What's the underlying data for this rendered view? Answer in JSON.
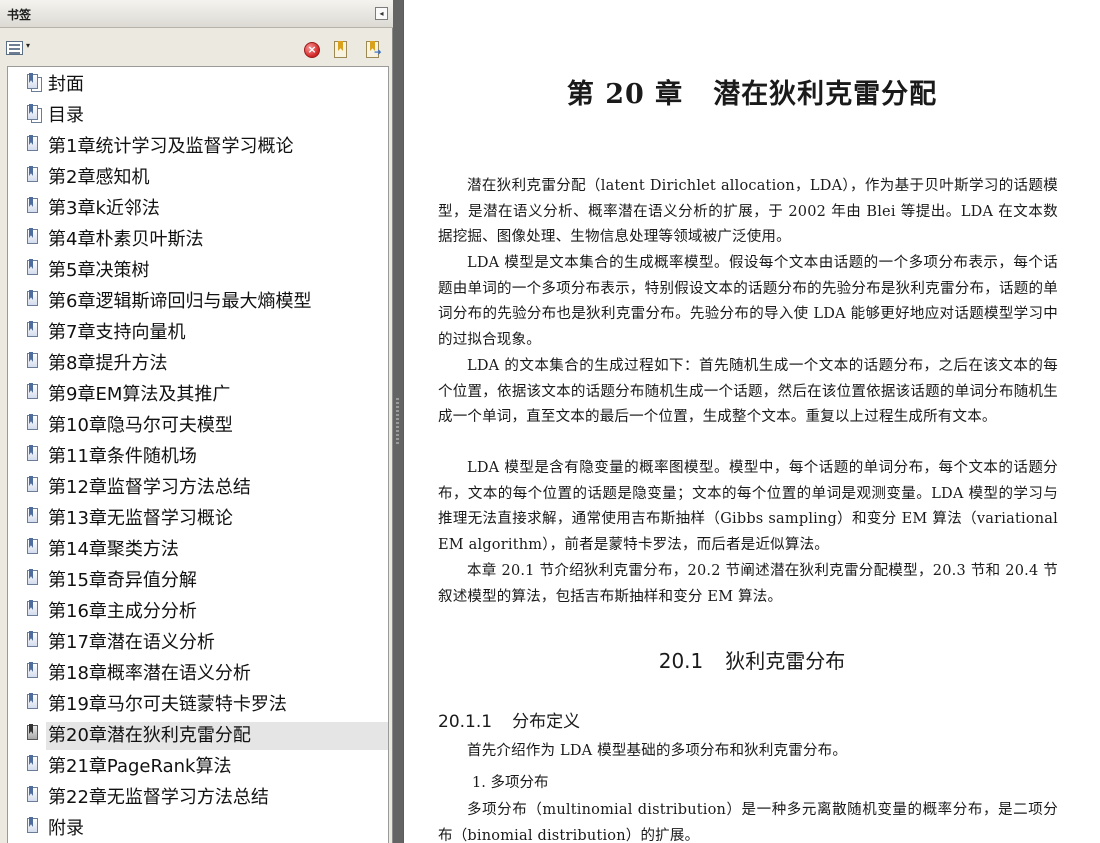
{
  "panel": {
    "title": "书签",
    "collapse_glyph": "◂",
    "options_caret": "▾",
    "delete_glyph": "×",
    "bookmarks": [
      {
        "label": "封面",
        "icon": "bookmark-multi-icon"
      },
      {
        "label": "目录",
        "icon": "bookmark-multi-icon"
      },
      {
        "label": "第1章统计学习及监督学习概论",
        "icon": "bookmark-icon"
      },
      {
        "label": "第2章感知机",
        "icon": "bookmark-icon"
      },
      {
        "label": "第3章k近邻法",
        "icon": "bookmark-icon"
      },
      {
        "label": "第4章朴素贝叶斯法",
        "icon": "bookmark-icon"
      },
      {
        "label": "第5章决策树",
        "icon": "bookmark-icon"
      },
      {
        "label": "第6章逻辑斯谛回归与最大熵模型",
        "icon": "bookmark-icon"
      },
      {
        "label": "第7章支持向量机",
        "icon": "bookmark-icon"
      },
      {
        "label": "第8章提升方法",
        "icon": "bookmark-icon"
      },
      {
        "label": "第9章EM算法及其推广",
        "icon": "bookmark-icon"
      },
      {
        "label": "第10章隐马尔可夫模型",
        "icon": "bookmark-icon"
      },
      {
        "label": "第11章条件随机场",
        "icon": "bookmark-icon"
      },
      {
        "label": "第12章监督学习方法总结",
        "icon": "bookmark-icon"
      },
      {
        "label": "第13章无监督学习概论",
        "icon": "bookmark-icon"
      },
      {
        "label": "第14章聚类方法",
        "icon": "bookmark-icon"
      },
      {
        "label": "第15章奇异值分解",
        "icon": "bookmark-icon"
      },
      {
        "label": "第16章主成分分析",
        "icon": "bookmark-icon"
      },
      {
        "label": "第17章潜在语义分析",
        "icon": "bookmark-icon"
      },
      {
        "label": "第18章概率潜在语义分析",
        "icon": "bookmark-icon"
      },
      {
        "label": "第19章马尔可夫链蒙特卡罗法",
        "icon": "bookmark-icon"
      },
      {
        "label": "第20章潜在狄利克雷分配",
        "icon": "bookmark-current-icon",
        "active": true
      },
      {
        "label": "第21章PageRank算法",
        "icon": "bookmark-icon"
      },
      {
        "label": "第22章无监督学习方法总结",
        "icon": "bookmark-icon"
      },
      {
        "label": "附录",
        "icon": "bookmark-icon"
      }
    ]
  },
  "document": {
    "chapter_number": "第 20 章",
    "chapter_name": "潜在狄利克雷分配",
    "paragraphs": [
      "潜在狄利克雷分配（latent Dirichlet allocation，LDA），作为基于贝叶斯学习的话题模型，是潜在语义分析、概率潜在语义分析的扩展，于 2002 年由 Blei 等提出。LDA 在文本数据挖掘、图像处理、生物信息处理等领域被广泛使用。",
      "LDA 模型是文本集合的生成概率模型。假设每个文本由话题的一个多项分布表示，每个话题由单词的一个多项分布表示，特别假设文本的话题分布的先验分布是狄利克雷分布，话题的单词分布的先验分布也是狄利克雷分布。先验分布的导入使 LDA 能够更好地应对话题模型学习中的过拟合现象。",
      "LDA 的文本集合的生成过程如下：首先随机生成一个文本的话题分布，之后在该文本的每个位置，依据该文本的话题分布随机生成一个话题，然后在该位置依据该话题的单词分布随机生成一个单词，直至文本的最后一个位置，生成整个文本。重复以上过程生成所有文本。",
      "LDA 模型是含有隐变量的概率图模型。模型中，每个话题的单词分布，每个文本的话题分布，文本的每个位置的话题是隐变量；文本的每个位置的单词是观测变量。LDA 模型的学习与推理无法直接求解，通常使用吉布斯抽样（Gibbs sampling）和变分 EM 算法（variational EM algorithm），前者是蒙特卡罗法，而后者是近似算法。",
      "本章 20.1 节介绍狄利克雷分布，20.2 节阐述潜在狄利克雷分配模型，20.3 节和 20.4 节叙述模型的算法，包括吉布斯抽样和变分 EM 算法。"
    ],
    "section_number": "20.1",
    "section_name": "狄利克雷分布",
    "subsection_number": "20.1.1",
    "subsection_name": "分布定义",
    "intro": "首先介绍作为 LDA 模型基础的多项分布和狄利克雷分布。",
    "item_title": "1. 多项分布",
    "item_text": "多项分布（multinomial distribution）是一种多元离散随机变量的概率分布，是二项分布（binomial distribution）的扩展。"
  }
}
